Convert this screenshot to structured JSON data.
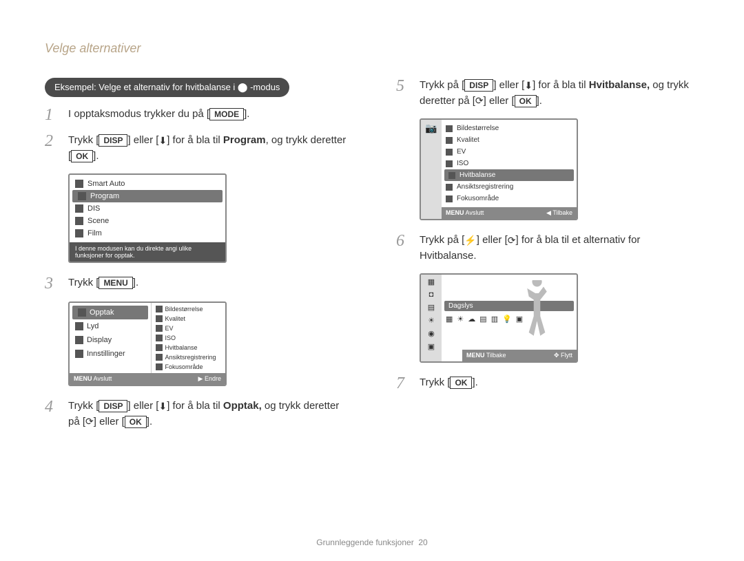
{
  "page_title": "Velge alternativer",
  "example_label": "Eksempel: Velge et alternativ for hvitbalanse i ⬤ -modus",
  "steps": {
    "s1_pre": "I opptaksmodus trykker du på [",
    "s1_btn": "MODE",
    "s1_post": "].",
    "s2_pre": "Trykk [",
    "s2_btn1": "DISP",
    "s2_mid1": "] eller [",
    "s2_icon1": "⬇",
    "s2_mid2": "] for å bla til ",
    "s2_bold": "Program",
    "s2_mid3": ", og trykk deretter [",
    "s2_btn2": "OK",
    "s2_post": "].",
    "s3_pre": "Trykk [",
    "s3_btn": "MENU",
    "s3_post": "].",
    "s4_pre": "Trykk [",
    "s4_btn1": "DISP",
    "s4_mid1": "] eller [",
    "s4_icon1": "⬇",
    "s4_mid2": "] for å bla til ",
    "s4_bold": "Opptak,",
    "s4_mid3": " og trykk deretter på [",
    "s4_icon2": "⟳",
    "s4_mid4": "] eller [",
    "s4_btn2": "OK",
    "s4_post": "].",
    "s5_pre": "Trykk på [",
    "s5_btn1": "DISP",
    "s5_mid1": "] eller [",
    "s5_icon1": "⬇",
    "s5_mid2": "] for å bla til ",
    "s5_bold": "Hvitbalanse,",
    "s5_mid3": " og trykk deretter på [",
    "s5_icon2": "⟳",
    "s5_mid4": "] eller [",
    "s5_btn2": "OK",
    "s5_post": "].",
    "s6_pre": "Trykk på [",
    "s6_icon1": "⚡",
    "s6_mid1": "] eller [",
    "s6_icon2": "⟳",
    "s6_mid2": "] for å bla til et alternativ for Hvitbalanse.",
    "s7_pre": "Trykk [",
    "s7_btn": "OK",
    "s7_post": "]."
  },
  "screenshot1": {
    "items": [
      "Smart Auto",
      "Program",
      "DIS",
      "Scene",
      "Film"
    ],
    "selected": 1,
    "desc": "I denne modusen kan du direkte angi ulike funksjoner for opptak."
  },
  "screenshot2": {
    "sidebar": [
      "Opptak",
      "Lyd",
      "Display",
      "Innstillinger"
    ],
    "sidebar_selected": 0,
    "right": [
      "Bildestørrelse",
      "Kvalitet",
      "EV",
      "ISO",
      "Hvitbalanse",
      "Ansiktsregistrering",
      "Fokusområde"
    ],
    "footer_left": "Avslutt",
    "footer_left_label": "MENU",
    "footer_right": "Endre",
    "footer_right_label": "▶"
  },
  "screenshot3": {
    "items": [
      "Bildestørrelse",
      "Kvalitet",
      "EV",
      "ISO",
      "Hvitbalanse",
      "Ansiktsregistrering",
      "Fokusområde"
    ],
    "selected": 4,
    "footer_left": "Avslutt",
    "footer_left_label": "MENU",
    "footer_right": "Tilbake",
    "footer_right_label": "◀"
  },
  "screenshot4": {
    "label": "Dagslys",
    "footer_left": "Tilbake",
    "footer_left_label": "MENU",
    "footer_right": "Flytt",
    "footer_right_label": "✥"
  },
  "footer": {
    "text": "Grunnleggende funksjoner",
    "page": "20"
  }
}
